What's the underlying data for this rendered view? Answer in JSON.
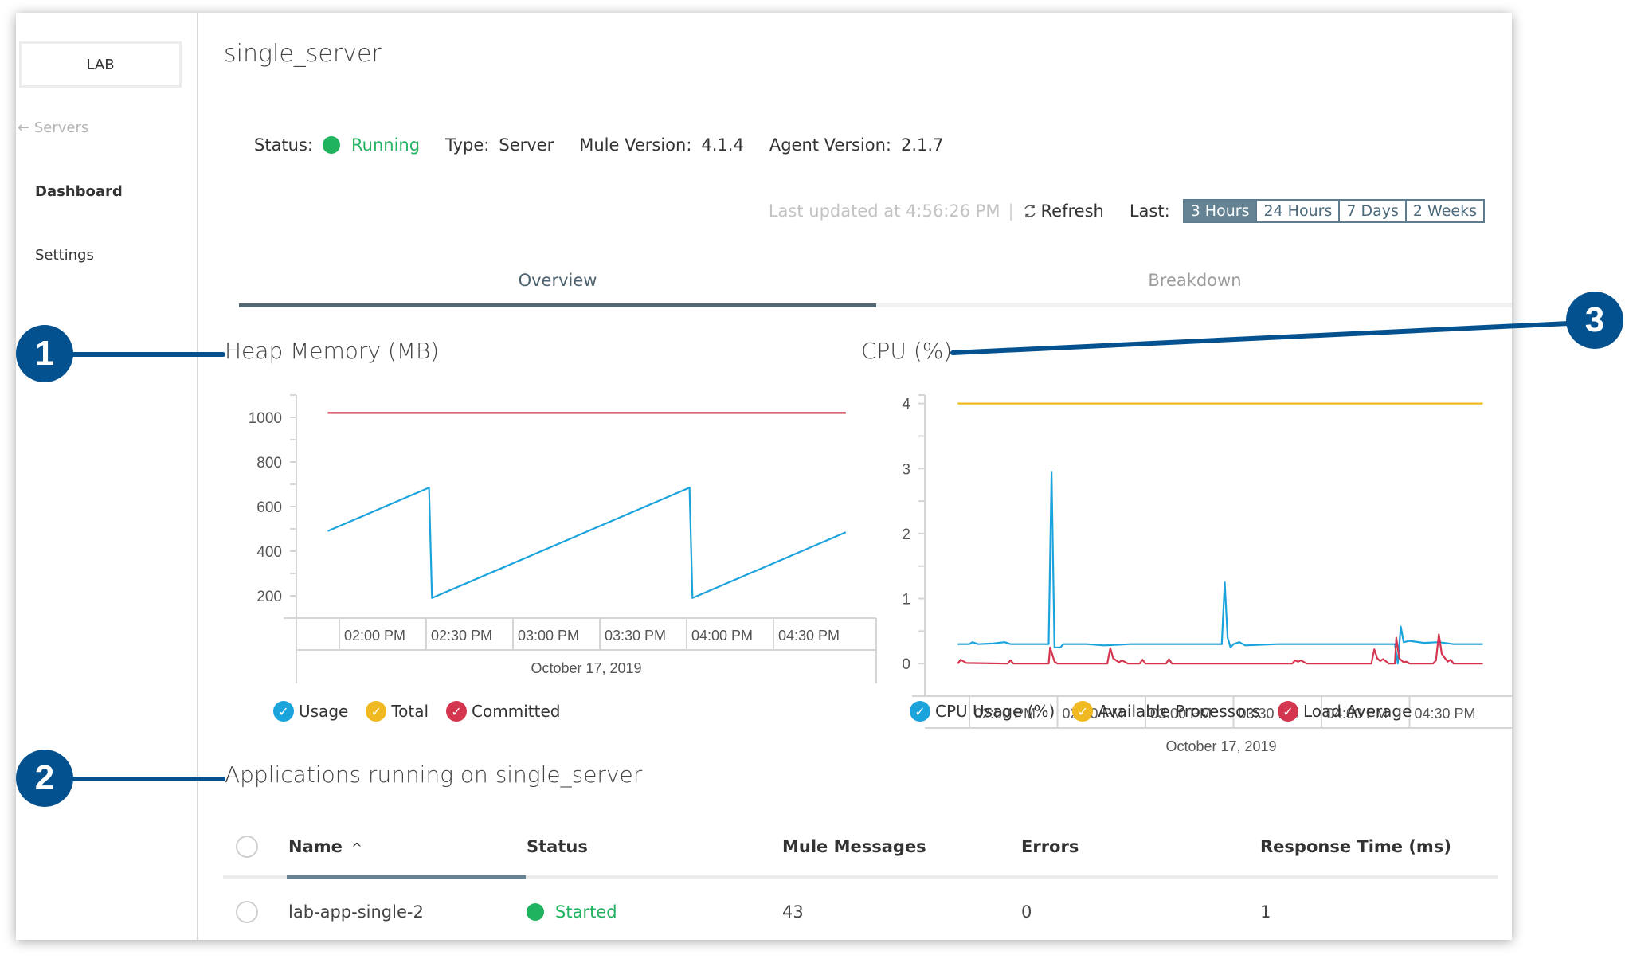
{
  "sidebar": {
    "environment": "LAB",
    "back_link": "Servers",
    "items": [
      {
        "label": "Dashboard",
        "active": true
      },
      {
        "label": "Settings",
        "active": false
      }
    ]
  },
  "header": {
    "title": "single_server",
    "status_label": "Status:",
    "status_value": "Running",
    "type_label": "Type:",
    "type_value": "Server",
    "mule_label": "Mule Version:",
    "mule_value": "4.1.4",
    "agent_label": "Agent Version:",
    "agent_value": "2.1.7",
    "last_updated": "Last updated at 4:56:26 PM",
    "refresh_label": "Refresh",
    "range_label": "Last:",
    "ranges": [
      "3 Hours",
      "24 Hours",
      "7 Days",
      "2 Weeks"
    ],
    "selected_range": "3 Hours"
  },
  "tabs": [
    {
      "label": "Overview",
      "active": true
    },
    {
      "label": "Breakdown",
      "active": false
    }
  ],
  "colors": {
    "usage": "#1ba3dc",
    "total": "#f0b922",
    "committed": "#d4364f",
    "status_green": "#1fb35f",
    "accent": "#668394",
    "callout": "#04518f"
  },
  "callouts": [
    "1",
    "2",
    "3"
  ],
  "chart_data": [
    {
      "type": "line",
      "title": "Heap Memory (MB)",
      "xlabel": "October 17, 2019",
      "ylabel": "",
      "ylim": [
        100,
        1100
      ],
      "yticks": [
        200,
        400,
        600,
        800,
        1000
      ],
      "xlim_minutes_from_2pm": [
        -8,
        188
      ],
      "xticks": [
        "02:00 PM",
        "02:30 PM",
        "03:00 PM",
        "03:30 PM",
        "04:00 PM",
        "04:30 PM"
      ],
      "xtick_minutes": [
        0,
        30,
        60,
        90,
        120,
        150
      ],
      "grid": false,
      "legend": "bottom",
      "series": [
        {
          "name": "Usage",
          "color_key": "usage",
          "points": [
            [
              -4,
              490
            ],
            [
              31,
              685
            ],
            [
              32,
              190
            ],
            [
              121,
              685
            ],
            [
              122,
              190
            ],
            [
              175,
              485
            ]
          ]
        },
        {
          "name": "Total",
          "color_key": "total",
          "points": []
        },
        {
          "name": "Committed",
          "color_key": "committed",
          "points": [
            [
              -4,
              1020
            ],
            [
              175,
              1020
            ]
          ]
        }
      ]
    },
    {
      "type": "line",
      "title": "CPU (%)",
      "xlabel": "October 17, 2019",
      "ylabel": "",
      "ylim": [
        -0.5,
        4.13
      ],
      "yticks": [
        0,
        1,
        2,
        3,
        4
      ],
      "xlim_minutes_from_2pm": [
        -12,
        184
      ],
      "xticks": [
        "02:00 PM",
        "02:30 PM",
        "03:00 PM",
        "03:30 PM",
        "04:00 PM",
        "04:30 PM"
      ],
      "xtick_minutes": [
        0,
        30,
        60,
        90,
        120,
        150
      ],
      "grid": false,
      "legend": "bottom",
      "series": [
        {
          "name": "CPU Usage (%)",
          "color_key": "usage",
          "points": [
            [
              -4,
              0.3
            ],
            [
              0,
              0.3
            ],
            [
              1,
              0.33
            ],
            [
              3,
              0.3
            ],
            [
              8,
              0.31
            ],
            [
              12,
              0.33
            ],
            [
              14,
              0.3
            ],
            [
              26,
              0.3
            ],
            [
              27,
              0.3
            ],
            [
              28,
              2.95
            ],
            [
              29,
              0.25
            ],
            [
              31,
              0.25
            ],
            [
              32,
              0.3
            ],
            [
              40,
              0.3
            ],
            [
              46,
              0.28
            ],
            [
              55,
              0.3
            ],
            [
              62,
              0.3
            ],
            [
              70,
              0.3
            ],
            [
              86,
              0.3
            ],
            [
              87,
              1.25
            ],
            [
              88,
              0.4
            ],
            [
              89,
              0.25
            ],
            [
              90,
              0.3
            ],
            [
              92,
              0.33
            ],
            [
              94,
              0.28
            ],
            [
              105,
              0.3
            ],
            [
              120,
              0.3
            ],
            [
              140,
              0.3
            ],
            [
              145,
              0.3
            ],
            [
              146,
              0.0
            ],
            [
              147,
              0.57
            ],
            [
              148,
              0.33
            ],
            [
              150,
              0.35
            ],
            [
              155,
              0.32
            ],
            [
              160,
              0.33
            ],
            [
              165,
              0.3
            ],
            [
              175,
              0.3
            ]
          ]
        },
        {
          "name": "Available Processors",
          "color_key": "total",
          "points": [
            [
              -4,
              4
            ],
            [
              175,
              4
            ]
          ]
        },
        {
          "name": "Load Average",
          "color_key": "committed",
          "points": [
            [
              -4,
              0
            ],
            [
              -3,
              0.06
            ],
            [
              -1,
              0.01
            ],
            [
              13,
              0
            ],
            [
              14,
              0.05
            ],
            [
              15,
              0
            ],
            [
              27,
              0
            ],
            [
              27.5,
              0.25
            ],
            [
              29,
              0.03
            ],
            [
              30,
              0
            ],
            [
              47,
              0
            ],
            [
              48,
              0.24
            ],
            [
              49,
              0.08
            ],
            [
              51,
              0.02
            ],
            [
              52,
              0.05
            ],
            [
              54,
              0
            ],
            [
              58,
              0
            ],
            [
              59,
              0.06
            ],
            [
              60,
              0
            ],
            [
              67,
              0
            ],
            [
              68,
              0.07
            ],
            [
              69,
              0
            ],
            [
              110,
              0
            ],
            [
              111,
              0.05
            ],
            [
              112,
              0.03
            ],
            [
              113,
              0.05
            ],
            [
              115,
              0
            ],
            [
              137,
              0
            ],
            [
              138,
              0.22
            ],
            [
              139,
              0.08
            ],
            [
              140,
              0.04
            ],
            [
              141,
              0.07
            ],
            [
              143,
              0
            ],
            [
              145,
              0
            ],
            [
              145.5,
              0.4
            ],
            [
              146.5,
              0.08
            ],
            [
              148,
              0.02
            ],
            [
              149,
              0.03
            ],
            [
              150,
              0
            ],
            [
              158,
              0
            ],
            [
              159,
              0.05
            ],
            [
              160,
              0.45
            ],
            [
              161,
              0.15
            ],
            [
              163,
              0.03
            ],
            [
              164,
              0.06
            ],
            [
              165,
              0
            ],
            [
              175,
              0
            ]
          ]
        }
      ]
    }
  ],
  "applications": {
    "title": "Applications running on single_server",
    "columns": [
      "Name",
      "Status",
      "Mule Messages",
      "Errors",
      "Response Time (ms)"
    ],
    "sort_indicator": "^",
    "rows": [
      {
        "name": "lab-app-single-2",
        "status": "Started",
        "messages": "43",
        "errors": "0",
        "response_time": "1"
      }
    ]
  }
}
